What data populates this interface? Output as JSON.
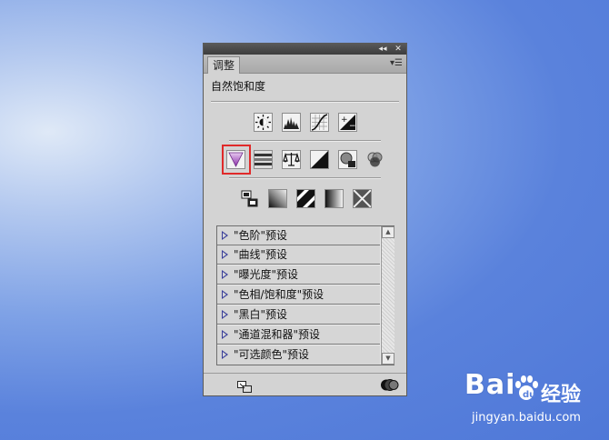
{
  "panel": {
    "tab_label": "调整",
    "adjustment_title": "自然饱和度",
    "icon_rows": [
      [
        "brightness-contrast-icon",
        "levels-icon",
        "curves-icon",
        "exposure-icon"
      ],
      [
        "vibrance-icon",
        "hue-saturation-icon",
        "color-balance-icon",
        "black-white-icon",
        "photo-filter-icon",
        "channel-mixer-icon"
      ],
      [
        "invert-icon",
        "posterize-icon",
        "threshold-icon",
        "gradient-map-icon",
        "selective-color-icon"
      ]
    ],
    "presets": [
      "\"色阶\"预设",
      "\"曲线\"预设",
      "\"曝光度\"预设",
      "\"色相/饱和度\"预设",
      "\"黑白\"预设",
      "\"通道混和器\"预设",
      "\"可选颜色\"预设"
    ],
    "colors": {
      "selection_highlight": "#e02a2a",
      "vibrance_accent": "#9b3fb7"
    }
  },
  "watermark": {
    "brand": "Bai",
    "brand_suffix": "经验",
    "url": "jingyan.baidu.com"
  }
}
